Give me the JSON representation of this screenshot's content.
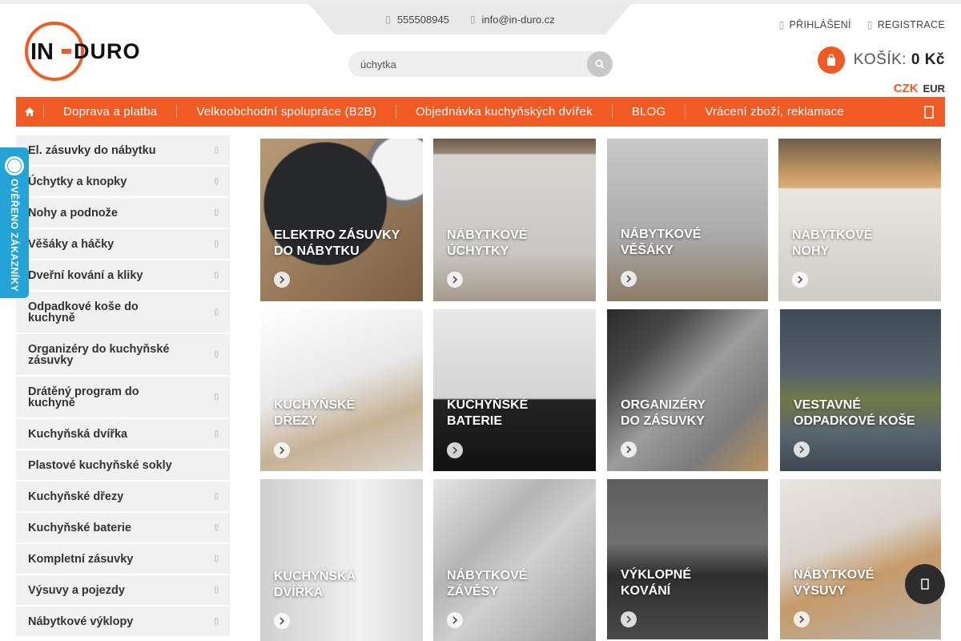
{
  "header": {
    "logo": {
      "text_left": "IN",
      "text_right": "DURO",
      "brand_color": "#f15a22"
    },
    "phone": "555508945",
    "email": "info@in-duro.cz",
    "login_label": "PŘIHLÁŠENÍ",
    "register_label": "REGISTRACE",
    "search": {
      "value": "úchytka",
      "placeholder": "úchytka"
    },
    "cart": {
      "label": "KOŠÍK:",
      "amount": "0 Kč"
    },
    "currency": {
      "selected": "CZK",
      "other": "EUR"
    }
  },
  "nav": {
    "items": [
      {
        "label": "Doprava a platba"
      },
      {
        "label": "Velkoobchodní spolupráce (B2B)"
      },
      {
        "label": "Objednávka kuchyňských dvířek"
      },
      {
        "label": "BLOG"
      },
      {
        "label": "Vrácení zboží, reklamace"
      }
    ]
  },
  "sidebar": {
    "items": [
      {
        "label": "El. zásuvky do nábytku"
      },
      {
        "label": "Úchytky a knopky"
      },
      {
        "label": "Nohy a podnože"
      },
      {
        "label": "Věšáky a háčky"
      },
      {
        "label": "Dveřní kování a kliky"
      },
      {
        "label": "Odpadkové koše do kuchyně"
      },
      {
        "label": "Organizéry do kuchyňské zásuvky"
      },
      {
        "label": "Drátěný program do kuchyně"
      },
      {
        "label": "Kuchyňská dvířka"
      },
      {
        "label": "Plastové kuchyňské sokly"
      },
      {
        "label": "Kuchyňské dřezy"
      },
      {
        "label": "Kuchyňské baterie"
      },
      {
        "label": "Kompletní zásuvky"
      },
      {
        "label": "Výsuvy a pojezdy"
      },
      {
        "label": "Nábytkové výklopy"
      }
    ]
  },
  "badge": {
    "label": "OVĚŘENO ZÁKAZNÍKY"
  },
  "tiles": [
    {
      "line1": "Elektro zásuvky",
      "line2": "do nábytku"
    },
    {
      "line1": "Nábytkové",
      "line2": "úchytky"
    },
    {
      "line1": "Nábytkové",
      "line2": "věšáky"
    },
    {
      "line1": "Nábytkové",
      "line2": "nohy"
    },
    {
      "line1": "Kuchyňské",
      "line2": "dřezy"
    },
    {
      "line1": "Kuchyňské",
      "line2": "baterie"
    },
    {
      "line1": "Organizéry",
      "line2": "do zásuvky"
    },
    {
      "line1": "Vestavné",
      "line2": "odpadkové koše"
    },
    {
      "line1": "Kuchyňská",
      "line2": "dvířka"
    },
    {
      "line1": "Nábytkové",
      "line2": "závěsy"
    },
    {
      "line1": "Výklopné",
      "line2": "kování"
    },
    {
      "line1": "Nábytkové",
      "line2": "výsuvy"
    }
  ],
  "colors": {
    "accent": "#f15a22",
    "badge": "#24a3d8",
    "sidebar_bg": "#f1f1f1"
  }
}
